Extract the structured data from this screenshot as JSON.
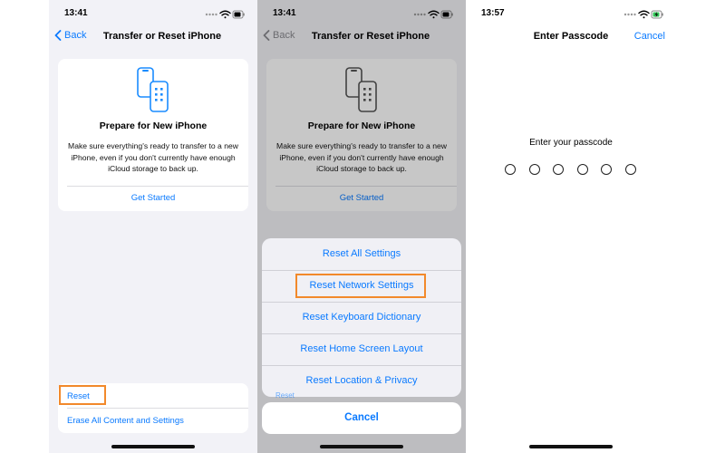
{
  "screen1": {
    "time": "13:41",
    "nav": {
      "back_label": "Back",
      "title": "Transfer or Reset iPhone"
    },
    "card": {
      "title": "Prepare for New iPhone",
      "body": "Make sure everything's ready to transfer to a new iPhone, even if you don't currently have enough iCloud storage to back up.",
      "link": "Get Started"
    },
    "reset_label": "Reset",
    "erase_label": "Erase All Content and Settings"
  },
  "screen2": {
    "time": "13:41",
    "nav": {
      "back_label": "Back",
      "title": "Transfer or Reset iPhone"
    },
    "card": {
      "title": "Prepare for New iPhone",
      "body": "Make sure everything's ready to transfer to a new iPhone, even if you don't currently have enough iCloud storage to back up.",
      "link": "Get Started"
    },
    "peek_label": "Reset",
    "sheet": {
      "items": [
        "Reset All Settings",
        "Reset Network Settings",
        "Reset Keyboard Dictionary",
        "Reset Home Screen Layout",
        "Reset Location & Privacy"
      ],
      "cancel": "Cancel"
    }
  },
  "screen3": {
    "time": "13:57",
    "nav": {
      "title": "Enter Passcode",
      "cancel": "Cancel"
    },
    "prompt": "Enter your passcode",
    "digit_count": 6
  },
  "colors": {
    "accent": "#0a7aff",
    "highlight": "#f2892b",
    "battery_charging": "#34c759"
  },
  "icons": [
    "wifi-icon",
    "battery-icon",
    "chevron-left-icon",
    "phones-transfer-icon"
  ]
}
